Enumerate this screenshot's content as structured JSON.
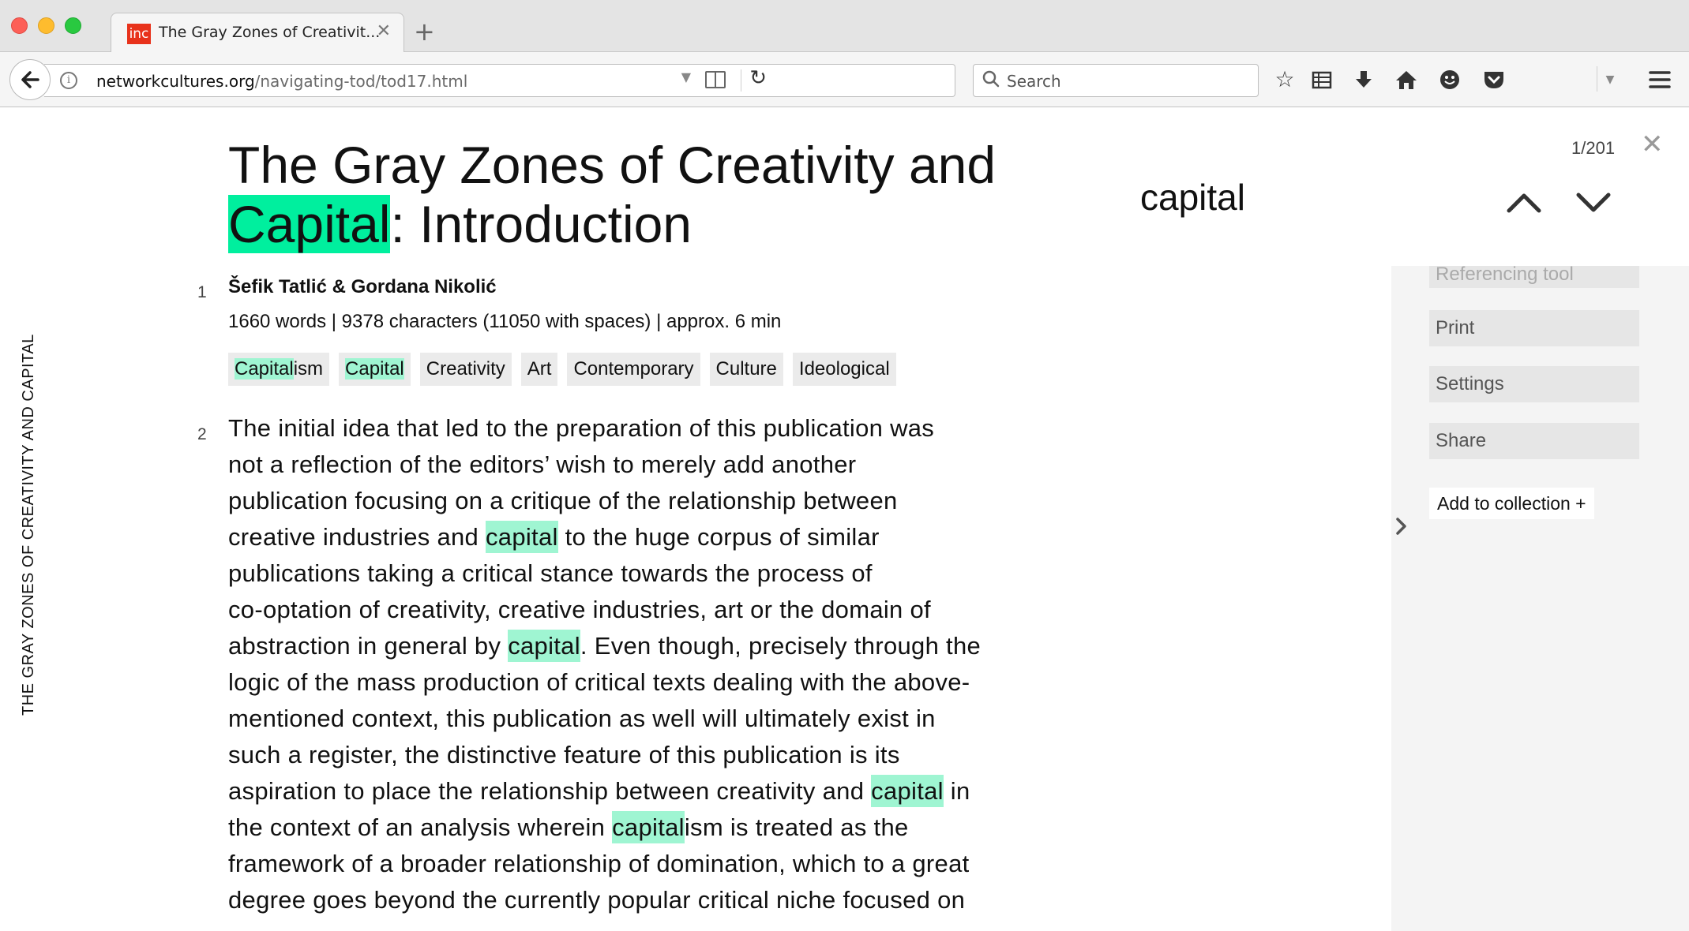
{
  "browser": {
    "tab_title": "The Gray Zones of Creativit...",
    "favicon_text": "inc",
    "tab_close": "✕",
    "new_tab": "+",
    "url_domain": "networkcultures.org",
    "url_path": "/navigating-tod/tod17.html",
    "search_placeholder": "Search"
  },
  "page": {
    "vertical_title": "THE GRAY ZONES OF CREATIVITY AND CAPITAL",
    "title_part1": "The Gray Zones of Creativity and",
    "title_highlight": "Capital",
    "title_part2": ": Introduction",
    "para1_num": "1",
    "authors": "Šefik Tatlić & Gordana Nikolić",
    "stats": "1660 words | 9378 characters (11050 with spaces) | approx. 6 min",
    "tags": [
      {
        "hl": "Capital",
        "rest": "ism"
      },
      {
        "hl": "Capital",
        "rest": ""
      },
      {
        "hl": "",
        "rest": "Creativity"
      },
      {
        "hl": "",
        "rest": "Art"
      },
      {
        "hl": "",
        "rest": "Contemporary"
      },
      {
        "hl": "",
        "rest": "Culture"
      },
      {
        "hl": "",
        "rest": "Ideological"
      }
    ],
    "para2_num": "2",
    "body_lines": [
      [
        "The initial idea that led to the preparation of this publication was"
      ],
      [
        "not a reflection of the editors’ wish to merely add another"
      ],
      [
        "publication focusing on a critique of the relationship between"
      ],
      [
        "creative industries and ",
        "capital",
        " to the huge corpus of similar"
      ],
      [
        "publications taking a critical stance towards the process of"
      ],
      [
        "co-optation of creativity, creative industries, art or the domain of"
      ],
      [
        "abstraction in general by ",
        "capital",
        ". Even though, precisely through the"
      ],
      [
        "logic of the mass production of critical texts dealing with the above-"
      ],
      [
        "mentioned context, this publication as well will ultimately exist in"
      ],
      [
        "such a register, the distinctive feature of this publication is its"
      ],
      [
        "aspiration to place the relationship between creativity and ",
        "capital",
        " in"
      ],
      [
        "the context of an analysis wherein ",
        "capital",
        "ism is treated as the"
      ],
      [
        "framework of a broader relationship of domination, which to a great"
      ],
      [
        "degree goes beyond the currently popular critical niche focused on"
      ]
    ]
  },
  "find": {
    "term": "capital",
    "count": "1/201",
    "close": "✕"
  },
  "panel": {
    "referencing": "Referencing tool",
    "print": "Print",
    "settings": "Settings",
    "share": "Share",
    "add_collection": "Add to collection +"
  },
  "colors": {
    "highlight_current": "#00ef9e",
    "highlight_other": "#9ff5d2"
  }
}
